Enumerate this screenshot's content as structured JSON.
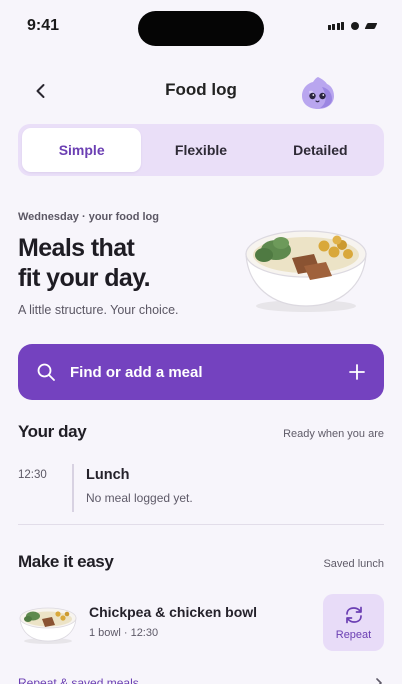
{
  "status_bar": {
    "time": "9:41"
  },
  "nav": {
    "title": "Food log",
    "back_icon": "chevron-left-icon",
    "mascot_icon": "ghost-mascot-icon"
  },
  "segments": [
    {
      "label": "Simple",
      "active": true
    },
    {
      "label": "Flexible",
      "active": false
    },
    {
      "label": "Detailed",
      "active": false
    }
  ],
  "hero": {
    "eyebrow": "Wednesday · your food log",
    "headline_line1": "Meals that",
    "headline_line2": "fit your day.",
    "subtext": "A little structure. Your choice."
  },
  "search": {
    "label": "Find or add a meal",
    "icon": "search-icon",
    "action_icon": "plus-icon"
  },
  "your_day": {
    "title": "Your day",
    "meta": "Ready when you are",
    "meal": {
      "time": "12:30",
      "name": "Lunch",
      "status": "No meal logged yet."
    }
  },
  "make_it_easy": {
    "title": "Make it easy",
    "meta": "Saved lunch",
    "item": {
      "name": "Chickpea & chicken bowl",
      "meta": "1 bowl · 12:30",
      "action_label": "Repeat",
      "action_icon": "repeat-icon"
    }
  },
  "bottom_link": {
    "label": "Repeat & saved meals",
    "icon": "chevron-right-icon"
  },
  "colors": {
    "accent": "#7442bf",
    "accent_soft": "#eadff8",
    "background": "#f7f5fb"
  }
}
